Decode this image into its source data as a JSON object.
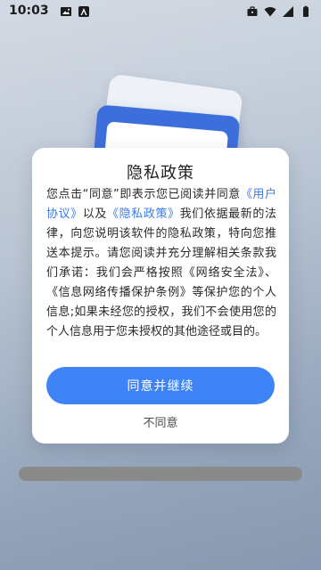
{
  "status_bar": {
    "time": "10:03",
    "left_icons": [
      "image-icon",
      "app-notification-icon"
    ],
    "right_icons": [
      "briefcase-icon",
      "wifi-icon",
      "signal-icon",
      "battery-icon"
    ]
  },
  "dialog": {
    "title": "隐私政策",
    "body": {
      "text_1": "您点击“同意”即表示您已阅读并同意",
      "link_user_agreement": "《用户协议》",
      "text_2": "以及",
      "link_privacy_policy": "《隐私政策》",
      "text_3": "我们依据最新的法律，向您说明该软件的隐私政策，特向您推送本提示。请您阅读并充分理解相关条款我们承诺：我们会严格按照《网络安全法》、《信息网络传播保护条例》等保护您的个人信息;如果未经您的授权，我们不会使用您的个人信息用于您未授权的其他途径或目的。"
    },
    "agree_label": "同意并继续",
    "disagree_label": "不同意"
  },
  "colors": {
    "accent": "#3e84f6",
    "link": "#3a7bea",
    "illustration_blue": "#3d6fdc"
  }
}
